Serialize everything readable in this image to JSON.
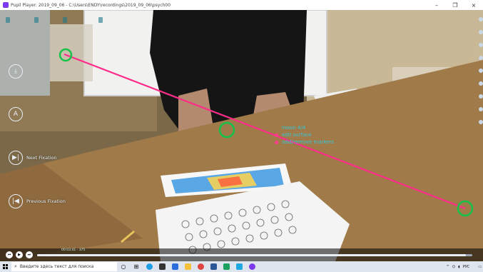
{
  "window": {
    "title": "Pupil Player: 2019_09_06 - C:\\Users\\ENDY\\recordings\\2019_09_06\\psych00",
    "minimize": "–",
    "maximize": "❐",
    "close": "×"
  },
  "status_badges": [
    "",
    "",
    "",
    ""
  ],
  "left_controls": [
    {
      "icon": "download-icon",
      "glyph": "⤓",
      "label": ""
    },
    {
      "icon": "annotation-icon",
      "glyph": "A",
      "label": ""
    },
    {
      "icon": "next-icon",
      "glyph": "▶|",
      "label": "Next Fixation"
    },
    {
      "icon": "previous-icon",
      "glyph": "|◀",
      "label": "Previous Fixation"
    }
  ],
  "surface_menu": {
    "title": "moon 4/4",
    "items": [
      "edit surface",
      "add/remove markers"
    ]
  },
  "playback": {
    "progress": 0.985,
    "time_left": "00:03:41 - 375",
    "time_right": "",
    "buttons": [
      "⏮",
      "▶",
      "⏭"
    ]
  },
  "taskbar": {
    "search_placeholder": "Введите здесь текст для поиска",
    "tray_lang": "РУС",
    "clock_time": "",
    "clock_date": ""
  },
  "colors": {
    "gaze_line": "#ff2d8a",
    "fixation": "#16c34a",
    "menu_text": "#36c6d8",
    "menu_dot": "#ff3b8d"
  }
}
